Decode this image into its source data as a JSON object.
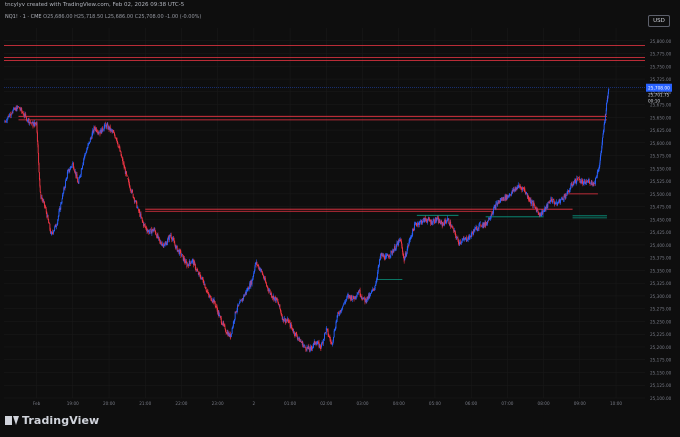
{
  "header": {
    "author_line": "tncylyv created with TradingView.com, Feb 02, 2026 09:38 UTC-5",
    "symbol": "NQ1! · 1 · CME",
    "ohlc": "O25,686.00  H25,718.50  L25,686.00  C25,708.00  -1.00 (-0.00%)",
    "currency": "USD"
  },
  "brand": {
    "name": "TradingView"
  },
  "chart_data": {
    "type": "candlestick",
    "ylim": [
      25100,
      25825
    ],
    "y_ticks": [
      25800,
      25775,
      25750,
      25725,
      25700,
      25675,
      25650,
      25625,
      25600,
      25575,
      25550,
      25525,
      25500,
      25475,
      25450,
      25425,
      25400,
      25375,
      25350,
      25325,
      25300,
      25275,
      25250,
      25225,
      25200,
      25175,
      25150,
      25125,
      25100
    ],
    "y_tick_labels": [
      "25,800.00",
      "25,775.00",
      "25,750.00",
      "25,725.00",
      "25,700.00",
      "25,675.00",
      "25,650.00",
      "25,625.00",
      "25,600.00",
      "25,575.00",
      "25,550.00",
      "25,525.00",
      "25,500.00",
      "25,475.00",
      "25,450.00",
      "25,425.00",
      "25,400.00",
      "25,375.00",
      "25,350.00",
      "25,325.00",
      "25,300.00",
      "25,275.00",
      "25,250.00",
      "25,225.00",
      "25,200.00",
      "25,175.00",
      "25,150.00",
      "25,125.00",
      "25,100.00"
    ],
    "x_tick_labels": [
      "Feb",
      "19:00",
      "20:00",
      "21:00",
      "22:00",
      "23:00",
      "2",
      "01:00",
      "02:00",
      "03:00",
      "04:00",
      "05:00",
      "06:00",
      "07:00",
      "08:00",
      "09:00",
      "10:00"
    ],
    "x_tick_hours": [
      17.0,
      18.0,
      19.0,
      20.0,
      21.0,
      22.0,
      23.0,
      24.0,
      25.0,
      26.0,
      27.0,
      28.0,
      29.0,
      30.0,
      31.0,
      32.0,
      33.0
    ],
    "x_range": [
      16.1,
      33.8
    ],
    "last_price": {
      "value": 25708.0,
      "label": "25,708.00",
      "sub_label": "25,701.75",
      "sub_label2": "00:10",
      "color": "#2962ff"
    },
    "price_path": [
      [
        16.1,
        25640
      ],
      [
        16.3,
        25660
      ],
      [
        16.5,
        25670
      ],
      [
        16.7,
        25650
      ],
      [
        16.9,
        25635
      ],
      [
        17.0,
        25640
      ],
      [
        17.1,
        25500
      ],
      [
        17.25,
        25470
      ],
      [
        17.4,
        25420
      ],
      [
        17.55,
        25440
      ],
      [
        17.7,
        25490
      ],
      [
        17.85,
        25540
      ],
      [
        18.0,
        25560
      ],
      [
        18.15,
        25520
      ],
      [
        18.3,
        25570
      ],
      [
        18.45,
        25600
      ],
      [
        18.6,
        25630
      ],
      [
        18.75,
        25620
      ],
      [
        18.9,
        25635
      ],
      [
        19.05,
        25625
      ],
      [
        19.2,
        25610
      ],
      [
        19.35,
        25570
      ],
      [
        19.5,
        25530
      ],
      [
        19.65,
        25500
      ],
      [
        19.8,
        25470
      ],
      [
        19.95,
        25440
      ],
      [
        20.1,
        25425
      ],
      [
        20.25,
        25430
      ],
      [
        20.4,
        25405
      ],
      [
        20.55,
        25400
      ],
      [
        20.7,
        25420
      ],
      [
        20.85,
        25395
      ],
      [
        21.0,
        25380
      ],
      [
        21.15,
        25360
      ],
      [
        21.3,
        25370
      ],
      [
        21.45,
        25345
      ],
      [
        21.6,
        25330
      ],
      [
        21.75,
        25300
      ],
      [
        21.9,
        25290
      ],
      [
        22.05,
        25260
      ],
      [
        22.2,
        25235
      ],
      [
        22.35,
        25220
      ],
      [
        22.5,
        25270
      ],
      [
        22.65,
        25290
      ],
      [
        22.8,
        25310
      ],
      [
        22.95,
        25330
      ],
      [
        23.05,
        25365
      ],
      [
        23.2,
        25350
      ],
      [
        23.35,
        25320
      ],
      [
        23.5,
        25300
      ],
      [
        23.65,
        25290
      ],
      [
        23.8,
        25255
      ],
      [
        23.95,
        25250
      ],
      [
        24.1,
        25230
      ],
      [
        24.25,
        25215
      ],
      [
        24.4,
        25200
      ],
      [
        24.55,
        25195
      ],
      [
        24.7,
        25210
      ],
      [
        24.85,
        25200
      ],
      [
        25.0,
        25235
      ],
      [
        25.15,
        25205
      ],
      [
        25.3,
        25260
      ],
      [
        25.45,
        25280
      ],
      [
        25.6,
        25300
      ],
      [
        25.75,
        25295
      ],
      [
        25.9,
        25310
      ],
      [
        26.05,
        25290
      ],
      [
        26.2,
        25300
      ],
      [
        26.35,
        25320
      ],
      [
        26.5,
        25380
      ],
      [
        26.65,
        25375
      ],
      [
        26.8,
        25385
      ],
      [
        26.95,
        25400
      ],
      [
        27.05,
        25410
      ],
      [
        27.15,
        25370
      ],
      [
        27.3,
        25410
      ],
      [
        27.45,
        25440
      ],
      [
        27.6,
        25445
      ],
      [
        27.75,
        25450
      ],
      [
        27.9,
        25445
      ],
      [
        28.05,
        25450
      ],
      [
        28.2,
        25440
      ],
      [
        28.35,
        25450
      ],
      [
        28.5,
        25430
      ],
      [
        28.65,
        25405
      ],
      [
        28.8,
        25410
      ],
      [
        28.95,
        25415
      ],
      [
        29.1,
        25430
      ],
      [
        29.25,
        25440
      ],
      [
        29.4,
        25440
      ],
      [
        29.55,
        25460
      ],
      [
        29.7,
        25480
      ],
      [
        29.85,
        25490
      ],
      [
        30.0,
        25495
      ],
      [
        30.15,
        25505
      ],
      [
        30.3,
        25515
      ],
      [
        30.45,
        25510
      ],
      [
        30.6,
        25490
      ],
      [
        30.75,
        25475
      ],
      [
        30.9,
        25460
      ],
      [
        31.05,
        25470
      ],
      [
        31.2,
        25490
      ],
      [
        31.35,
        25480
      ],
      [
        31.5,
        25490
      ],
      [
        31.65,
        25500
      ],
      [
        31.8,
        25520
      ],
      [
        31.95,
        25530
      ],
      [
        32.1,
        25520
      ],
      [
        32.25,
        25525
      ],
      [
        32.4,
        25520
      ],
      [
        32.55,
        25560
      ],
      [
        32.65,
        25620
      ],
      [
        32.75,
        25680
      ],
      [
        32.8,
        25708
      ]
    ],
    "levels": [
      {
        "y": 25791,
        "x0": 16.1,
        "x1": 33.8,
        "color": "#f23645"
      },
      {
        "y": 25767,
        "x0": 16.1,
        "x1": 33.8,
        "color": "#f23645"
      },
      {
        "y": 25761,
        "x0": 16.1,
        "x1": 33.8,
        "color": "#f23645"
      },
      {
        "y": 25652,
        "x0": 16.5,
        "x1": 32.75,
        "color": "#f23645"
      },
      {
        "y": 25645,
        "x0": 16.5,
        "x1": 32.75,
        "color": "#f23645"
      },
      {
        "y": 25470,
        "x0": 20.0,
        "x1": 31.8,
        "color": "#f23645"
      },
      {
        "y": 25466,
        "x0": 20.0,
        "x1": 29.6,
        "color": "#f23645"
      },
      {
        "y": 25455,
        "x0": 29.4,
        "x1": 31.0,
        "color": "#089981"
      },
      {
        "y": 25457,
        "x0": 31.8,
        "x1": 32.75,
        "color": "#089981"
      },
      {
        "y": 25453,
        "x0": 31.8,
        "x1": 32.75,
        "color": "#089981"
      },
      {
        "y": 25458,
        "x0": 27.5,
        "x1": 28.65,
        "color": "#089981"
      },
      {
        "y": 25332,
        "x0": 26.4,
        "x1": 27.1,
        "color": "#089981"
      },
      {
        "y": 25500,
        "x0": 31.6,
        "x1": 32.5,
        "color": "#f23645"
      }
    ],
    "colors": {
      "up": "#2962ff",
      "down": "#f23645",
      "grid": "#1b1b1b",
      "background": "#0e0e0e"
    }
  }
}
